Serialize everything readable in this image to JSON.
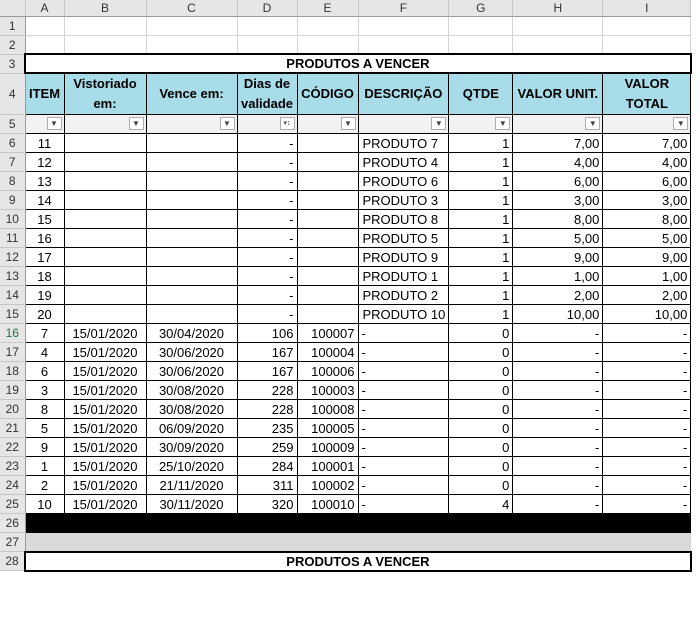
{
  "columns": [
    "A",
    "B",
    "C",
    "D",
    "E",
    "F",
    "G",
    "H",
    "I"
  ],
  "row_numbers": [
    "1",
    "2",
    "3",
    "4",
    "5",
    "6",
    "7",
    "8",
    "9",
    "10",
    "11",
    "12",
    "13",
    "14",
    "15",
    "16",
    "17",
    "18",
    "19",
    "20",
    "21",
    "22",
    "23",
    "24",
    "25",
    "26",
    "27",
    "28"
  ],
  "table_title": "PRODUTOS A VENCER",
  "headers": {
    "item": "ITEM",
    "vistoriado": "Vistoriado em:",
    "vence": "Vence em:",
    "dias": "Dias de validade",
    "codigo": "CÓDIGO",
    "descricao": "DESCRIÇÃO",
    "qtde": "QTDE",
    "valor_unit": "VALOR UNIT.",
    "valor_total": "VALOR TOTAL"
  },
  "filter_icon": "dropdown-arrow-icon",
  "sorted_filter_icon": "sort-filter-icon",
  "rows": [
    {
      "item": "11",
      "vistoriado": "",
      "vence": "",
      "dias": "-",
      "codigo": "",
      "descricao": "PRODUTO 7",
      "qtde": "1",
      "valor_unit": "7,00",
      "valor_total": "7,00"
    },
    {
      "item": "12",
      "vistoriado": "",
      "vence": "",
      "dias": "-",
      "codigo": "",
      "descricao": "PRODUTO 4",
      "qtde": "1",
      "valor_unit": "4,00",
      "valor_total": "4,00"
    },
    {
      "item": "13",
      "vistoriado": "",
      "vence": "",
      "dias": "-",
      "codigo": "",
      "descricao": "PRODUTO 6",
      "qtde": "1",
      "valor_unit": "6,00",
      "valor_total": "6,00"
    },
    {
      "item": "14",
      "vistoriado": "",
      "vence": "",
      "dias": "-",
      "codigo": "",
      "descricao": "PRODUTO 3",
      "qtde": "1",
      "valor_unit": "3,00",
      "valor_total": "3,00"
    },
    {
      "item": "15",
      "vistoriado": "",
      "vence": "",
      "dias": "-",
      "codigo": "",
      "descricao": "PRODUTO 8",
      "qtde": "1",
      "valor_unit": "8,00",
      "valor_total": "8,00"
    },
    {
      "item": "16",
      "vistoriado": "",
      "vence": "",
      "dias": "-",
      "codigo": "",
      "descricao": "PRODUTO 5",
      "qtde": "1",
      "valor_unit": "5,00",
      "valor_total": "5,00"
    },
    {
      "item": "17",
      "vistoriado": "",
      "vence": "",
      "dias": "-",
      "codigo": "",
      "descricao": "PRODUTO 9",
      "qtde": "1",
      "valor_unit": "9,00",
      "valor_total": "9,00"
    },
    {
      "item": "18",
      "vistoriado": "",
      "vence": "",
      "dias": "-",
      "codigo": "",
      "descricao": "PRODUTO 1",
      "qtde": "1",
      "valor_unit": "1,00",
      "valor_total": "1,00"
    },
    {
      "item": "19",
      "vistoriado": "",
      "vence": "",
      "dias": "-",
      "codigo": "",
      "descricao": "PRODUTO 2",
      "qtde": "1",
      "valor_unit": "2,00",
      "valor_total": "2,00"
    },
    {
      "item": "20",
      "vistoriado": "",
      "vence": "",
      "dias": "-",
      "codigo": "",
      "descricao": "PRODUTO 10",
      "qtde": "1",
      "valor_unit": "10,00",
      "valor_total": "10,00"
    },
    {
      "item": "7",
      "vistoriado": "15/01/2020",
      "vence": "30/04/2020",
      "dias": "106",
      "codigo": "100007",
      "descricao": "-",
      "qtde": "0",
      "valor_unit": "-",
      "valor_total": "-"
    },
    {
      "item": "4",
      "vistoriado": "15/01/2020",
      "vence": "30/06/2020",
      "dias": "167",
      "codigo": "100004",
      "descricao": "-",
      "qtde": "0",
      "valor_unit": "-",
      "valor_total": "-"
    },
    {
      "item": "6",
      "vistoriado": "15/01/2020",
      "vence": "30/06/2020",
      "dias": "167",
      "codigo": "100006",
      "descricao": "-",
      "qtde": "0",
      "valor_unit": "-",
      "valor_total": "-"
    },
    {
      "item": "3",
      "vistoriado": "15/01/2020",
      "vence": "30/08/2020",
      "dias": "228",
      "codigo": "100003",
      "descricao": "-",
      "qtde": "0",
      "valor_unit": "-",
      "valor_total": "-"
    },
    {
      "item": "8",
      "vistoriado": "15/01/2020",
      "vence": "30/08/2020",
      "dias": "228",
      "codigo": "100008",
      "descricao": "-",
      "qtde": "0",
      "valor_unit": "-",
      "valor_total": "-"
    },
    {
      "item": "5",
      "vistoriado": "15/01/2020",
      "vence": "06/09/2020",
      "dias": "235",
      "codigo": "100005",
      "descricao": "-",
      "qtde": "0",
      "valor_unit": "-",
      "valor_total": "-"
    },
    {
      "item": "9",
      "vistoriado": "15/01/2020",
      "vence": "30/09/2020",
      "dias": "259",
      "codigo": "100009",
      "descricao": "-",
      "qtde": "0",
      "valor_unit": "-",
      "valor_total": "-"
    },
    {
      "item": "1",
      "vistoriado": "15/01/2020",
      "vence": "25/10/2020",
      "dias": "284",
      "codigo": "100001",
      "descricao": "-",
      "qtde": "0",
      "valor_unit": "-",
      "valor_total": "-"
    },
    {
      "item": "2",
      "vistoriado": "15/01/2020",
      "vence": "21/11/2020",
      "dias": "311",
      "codigo": "100002",
      "descricao": "-",
      "qtde": "0",
      "valor_unit": "-",
      "valor_total": "-"
    },
    {
      "item": "10",
      "vistoriado": "15/01/2020",
      "vence": "30/11/2020",
      "dias": "320",
      "codigo": "100010",
      "descricao": "-",
      "qtde": "4",
      "valor_unit": "-",
      "valor_total": "-"
    }
  ],
  "colors": {
    "header_fill": "#a8dce9",
    "filter_fill": "#f2f2f2",
    "band_black": "#000000",
    "band_grey": "#d9d9d9",
    "selected_row_number": "#217346"
  }
}
